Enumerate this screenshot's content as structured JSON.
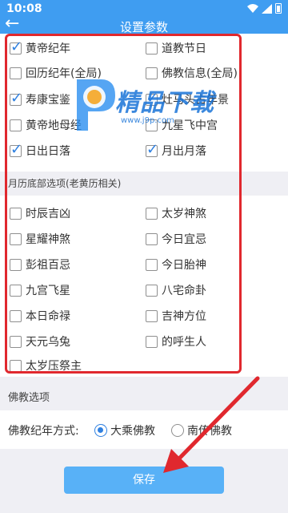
{
  "status_bar": {
    "time": "10:08"
  },
  "app_bar": {
    "title": "设置参数",
    "back_icon": "arrow-left-icon"
  },
  "primary_options": [
    {
      "label": "黄帝纪年",
      "checked": true
    },
    {
      "label": "道教节日",
      "checked": false
    },
    {
      "label": "回历纪年(全局)",
      "checked": false
    },
    {
      "label": "佛教信息(全局)",
      "checked": false
    },
    {
      "label": "寿康宝鉴",
      "checked": true
    },
    {
      "label": "灶马头占年景",
      "checked": true
    },
    {
      "label": "黄帝地母经",
      "checked": false
    },
    {
      "label": "九星飞中宫",
      "checked": false
    },
    {
      "label": "日出日落",
      "checked": true
    },
    {
      "label": "月出月落",
      "checked": true
    }
  ],
  "lunar_section": {
    "header": "月历底部选项(老黄历相关)",
    "options": [
      {
        "label": "时辰吉凶",
        "checked": false
      },
      {
        "label": "太岁神煞",
        "checked": false
      },
      {
        "label": "星耀神煞",
        "checked": false
      },
      {
        "label": "今日宜忌",
        "checked": false
      },
      {
        "label": "彭祖百忌",
        "checked": false
      },
      {
        "label": "今日胎神",
        "checked": false
      },
      {
        "label": "九宫飞星",
        "checked": false
      },
      {
        "label": "八宅命卦",
        "checked": false
      },
      {
        "label": "本日命禄",
        "checked": false
      },
      {
        "label": "吉神方位",
        "checked": false
      },
      {
        "label": "天元乌兔",
        "checked": false
      },
      {
        "label": "的呼生人",
        "checked": false
      },
      {
        "label": "太岁压祭主",
        "checked": false
      }
    ]
  },
  "buddhist_section": {
    "header": "佛教选项",
    "label": "佛教纪年方式:",
    "options": [
      {
        "label": "大乘佛教",
        "selected": true
      },
      {
        "label": "南传佛教",
        "selected": false
      }
    ]
  },
  "save_label": "保存",
  "watermark": {
    "name": "精品下载",
    "url": "www.j9p.com"
  },
  "colors": {
    "accent": "#3f9df1",
    "check": "#2f80e0",
    "highlight": "#e0282e",
    "save": "#58b1f7"
  }
}
